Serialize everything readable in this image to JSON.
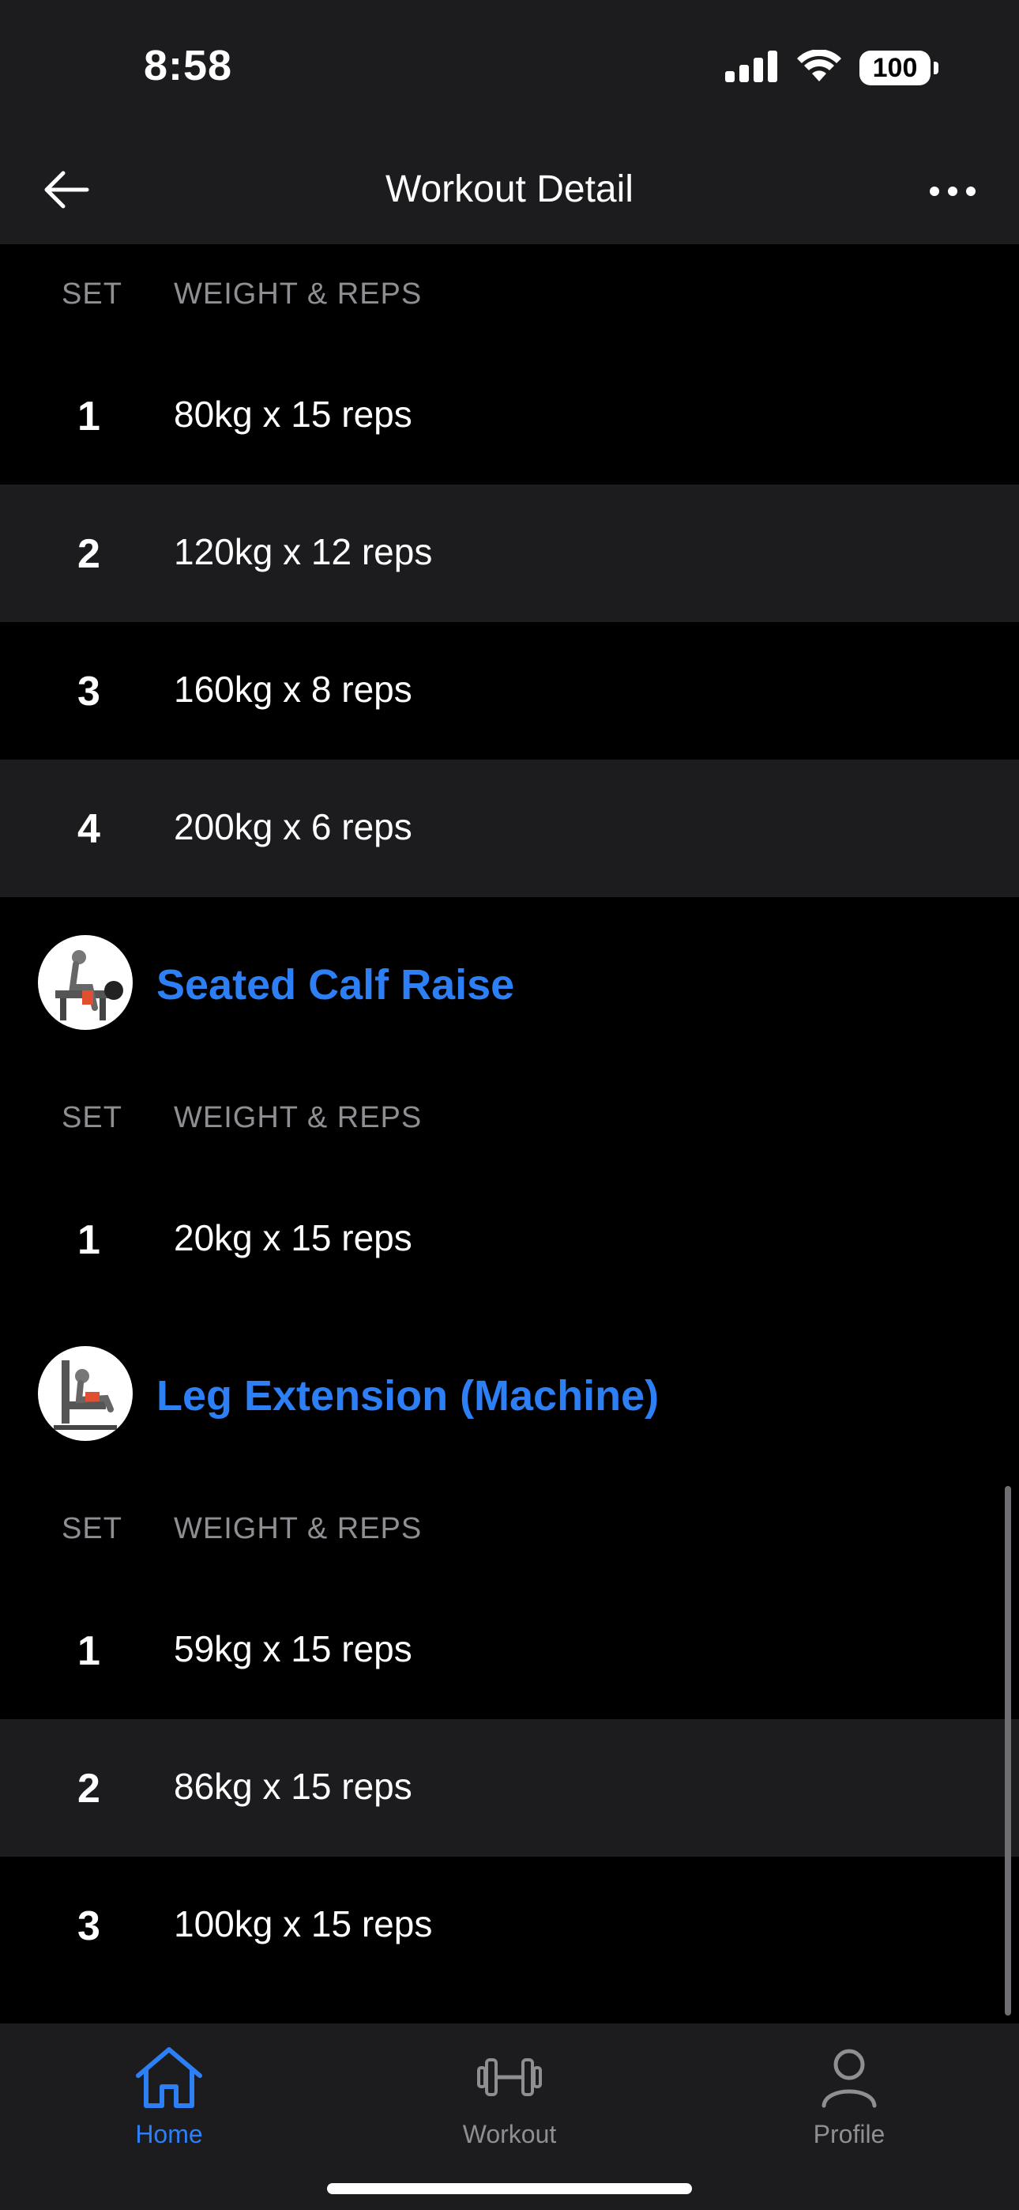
{
  "status": {
    "time": "8:58",
    "battery": "100"
  },
  "header": {
    "title": "Workout Detail"
  },
  "columns": {
    "set": "SET",
    "weight_reps": "WEIGHT & REPS"
  },
  "exercises": [
    {
      "name": "",
      "sets": [
        {
          "num": "1",
          "wr": "80kg x 15 reps"
        },
        {
          "num": "2",
          "wr": "120kg x 12 reps"
        },
        {
          "num": "3",
          "wr": "160kg x 8 reps"
        },
        {
          "num": "4",
          "wr": "200kg x 6 reps"
        }
      ]
    },
    {
      "name": "Seated Calf Raise",
      "sets": [
        {
          "num": "1",
          "wr": "20kg x 15 reps"
        }
      ]
    },
    {
      "name": "Leg Extension (Machine)",
      "sets": [
        {
          "num": "1",
          "wr": "59kg x 15 reps"
        },
        {
          "num": "2",
          "wr": "86kg x 15 reps"
        },
        {
          "num": "3",
          "wr": "100kg x 15 reps"
        }
      ]
    }
  ],
  "tabs": {
    "home": "Home",
    "workout": "Workout",
    "profile": "Profile"
  },
  "colors": {
    "accent": "#2d7ff5",
    "bar": "#1c1c1e",
    "muted": "#8e8e93"
  }
}
